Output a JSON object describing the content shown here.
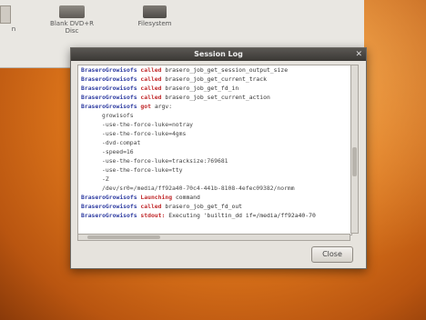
{
  "desktop": {
    "items": [
      {
        "label": "n"
      },
      {
        "label": "Blank DVD+R Disc"
      },
      {
        "label": "Filesystem"
      }
    ]
  },
  "dialog": {
    "title": "Session Log",
    "close_label": "Close",
    "lines": [
      {
        "name": "BraseroGrowisofs",
        "verb": "called",
        "text": "brasero_job_get_session_output_size"
      },
      {
        "name": "BraseroGrowisofs",
        "verb": "called",
        "text": "brasero_job_get_current_track"
      },
      {
        "name": "BraseroGrowisofs",
        "verb": "called",
        "text": "brasero_job_get_fd_in"
      },
      {
        "name": "BraseroGrowisofs",
        "verb": "called",
        "text": "brasero_job_set_current_action"
      },
      {
        "name": "BraseroGrowisofs",
        "verb": "got",
        "text": "argv:"
      },
      {
        "indent": true,
        "text": "growisofs"
      },
      {
        "indent": true,
        "text": "-use-the-force-luke=notray"
      },
      {
        "indent": true,
        "text": "-use-the-force-luke=4gms"
      },
      {
        "indent": true,
        "text": "-dvd-compat"
      },
      {
        "indent": true,
        "text": "-speed=16"
      },
      {
        "indent": true,
        "text": "-use-the-force-luke=tracksize:769681"
      },
      {
        "indent": true,
        "text": "-use-the-force-luke=tty"
      },
      {
        "indent": true,
        "text": "-Z"
      },
      {
        "indent": true,
        "text": "/dev/sr0=/media/ff92a40-70c4-441b-8108-4efec09382/normm"
      },
      {
        "name": "BraseroGrowisofs",
        "verb": "Launching",
        "text": "command"
      },
      {
        "name": "BraseroGrowisofs",
        "verb": "called",
        "text": "brasero_job_get_fd_out"
      },
      {
        "name": "BraseroGrowisofs",
        "verb": "stdout:",
        "text": "Executing 'builtin_dd if=/media/ff92a40-70"
      }
    ]
  },
  "colors": {
    "name": "#2c3aa0",
    "verb": "#c0282a",
    "desktop": "#e0781c"
  }
}
